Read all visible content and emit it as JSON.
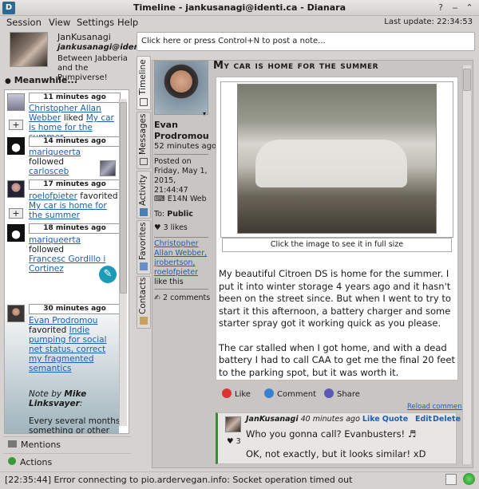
{
  "window": {
    "title": "Timeline - jankusanagi@identi.ca - Dianara",
    "app_icon": "D"
  },
  "menu": {
    "items": [
      "Session",
      "View",
      "Settings",
      "Help"
    ],
    "last_update": "Last update: 22:34:53"
  },
  "profile": {
    "name": "JanKusanagi",
    "id": "jankusanagi@identi.ca",
    "bio": "Between Jabberia and the Pumpiverse!"
  },
  "composer": {
    "placeholder": "Click here or press Control+N to post a note..."
  },
  "meanwhile": {
    "header": "Meanwhile...",
    "items": [
      {
        "time": "11 minutes ago",
        "actor": "Christopher Allan Webber",
        "verb": "liked",
        "object": "My car is home for the summer",
        "icon": "avatar-robot"
      },
      {
        "time": "14 minutes ago",
        "actor": "mariqueerta",
        "verb": "followed",
        "object": "carlosceb",
        "icon": "tux-icon"
      },
      {
        "time": "17 minutes ago",
        "actor": "roelofpieter",
        "verb": "favorited",
        "object": "My car is home for the summer",
        "icon": "avatar-person"
      },
      {
        "time": "18 minutes ago",
        "actor": "mariqueerta",
        "verb": "followed",
        "object": "Francesc Gordillo i Cortinez",
        "icon": "tux-icon"
      },
      {
        "time": "30 minutes ago",
        "actor": "Evan Prodromou",
        "verb": "favorited",
        "object": "Indie pumping for social net status, correct my fragmented semantics",
        "note_prefix": "Note by",
        "note_author": "Mike Linksvayer",
        "note_body": "Every several months something or other prompts me to take a"
      }
    ]
  },
  "bottom_tabs": {
    "mentions": "Mentions",
    "actions": "Actions"
  },
  "vertical_tabs": [
    "Timeline",
    "Messages",
    "Activity",
    "Favorites",
    "Contacts"
  ],
  "post": {
    "title": "My car is home for the summer",
    "author": "Evan Prodromou",
    "age": "52 minutes ago",
    "posted_on": "Posted on Friday, May 1, 2015, 21:44:47",
    "client": "E14N Web",
    "to_label": "To:",
    "to": "Public",
    "likes": "3 likes",
    "likers": "Christopher Allan Webber, jrobertson, roelofpieter",
    "likers_suffix": "like this",
    "comments_count": "2 comments",
    "image_hint": "Click the image to see it in full size",
    "body_p1": "My beautiful Citroen DS is home for the summer. I put it into winter storage 4 years ago and it hasn't been on the street since. But when I went to try to start it this afternoon, a battery charger and some starter spray got it working quick as you please.",
    "body_p2": "The car stalled when I got home, and with a dead battery I had to call CAA to get me the final 20 feet to the parking spot, but it was worth it.",
    "actions": {
      "like": "Like",
      "comment": "Comment",
      "share": "Share"
    },
    "reload_comments": "Reload comments"
  },
  "comment": {
    "author": "JanKusanagi",
    "age": "40 minutes ago",
    "like": "Like",
    "quote": "Quote",
    "edit": "Edit",
    "delete": "Delete",
    "likes": "3",
    "text1": "Who you gonna call? Evanbusters! ♬",
    "text2": "OK, not exactly, but it looks similar! xD"
  },
  "status": {
    "text": "[22:35:44] Error connecting to pio.ardervegan.info: Socket operation timed out"
  }
}
